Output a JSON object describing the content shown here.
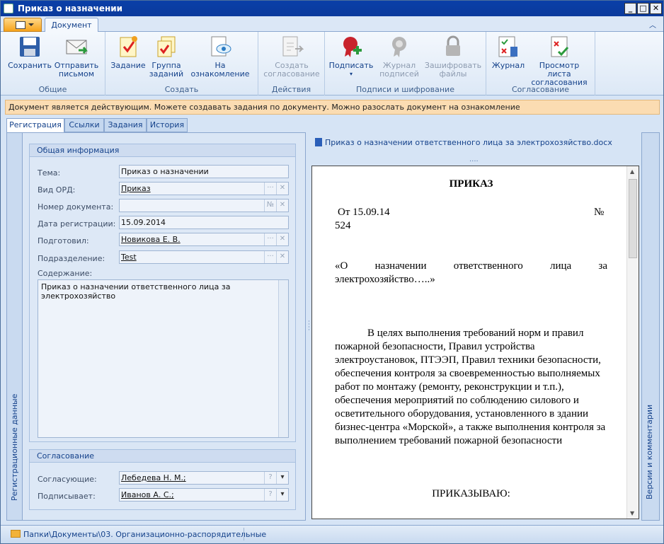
{
  "window": {
    "title": "Приказ о назначении"
  },
  "ribbon": {
    "tab": "Документ",
    "groups": [
      {
        "label": "Общие",
        "buttons": [
          "Сохранить",
          "Отправить письмом"
        ]
      },
      {
        "label": "Создать",
        "buttons": [
          "Задание",
          "Группа заданий",
          "На ознакомление"
        ]
      },
      {
        "label": "Действия",
        "buttons": [
          "Создать согласование"
        ]
      },
      {
        "label": "Подписи и шифрование",
        "buttons": [
          "Подписать",
          "Журнал подписей",
          "Зашифровать файлы"
        ]
      },
      {
        "label": "Согласование",
        "buttons": [
          "Журнал",
          "Просмотр листа согласования"
        ]
      }
    ]
  },
  "message": "Документ является действующим. Можете создавать задания по документу. Можно разослать документ на ознакомление",
  "tabs": [
    "Регистрация",
    "Ссылки",
    "Задания",
    "История"
  ],
  "side_left": "Регистрационные данные",
  "side_right": "Версии и комментарии",
  "general": {
    "title": "Общая информация",
    "fields": [
      {
        "label": "Тема:",
        "value": "Приказ о назначении"
      },
      {
        "label": "Вид ОРД:",
        "value": "Приказ"
      },
      {
        "label": "Номер документа:",
        "value": ""
      },
      {
        "label": "Дата регистрации:",
        "value": "15.09.2014"
      },
      {
        "label": "Подготовил:",
        "value": "Новикова Е. В."
      },
      {
        "label": "Подразделение:",
        "value": "Test"
      }
    ],
    "content_label": "Содержание:",
    "content_value": "Приказ о назначении ответственного лица за электрохозяйство"
  },
  "approval": {
    "title": "Согласование",
    "approvers_label": "Согласующие:",
    "approvers_value": "Лебедева Н. М.;",
    "signer_label": "Подписывает:",
    "signer_value": "Иванов А. С.;"
  },
  "file": {
    "name": "Приказ о назначении ответственного лица за электрохозяйство.docx"
  },
  "document": {
    "heading": "ПРИКАЗ",
    "date_line": "От 15.09.14",
    "number_sign": "№",
    "number": "524",
    "subject": "«О назначении ответственного лица за электрохозяйство…..»",
    "body": "В целях выполнения требований норм и правил пожарной безопасности, Правил устройства электроустановок, ПТЭЭП, Правил техники безопасности, обеспечения контроля за своевременностью выполняемых работ по монтажу (ремонту, реконструкции и т.п.), обеспечения мероприятий по соблюдению силового и осветительного оборудования, установленного в здании бизнес-центра «Морской», а также выполнения контроля за выполнением требований пожарной безопасности",
    "order": "ПРИКАЗЫВАЮ:"
  },
  "status": {
    "path": "Папки\\Документы\\03. Организационно-распорядительные"
  }
}
